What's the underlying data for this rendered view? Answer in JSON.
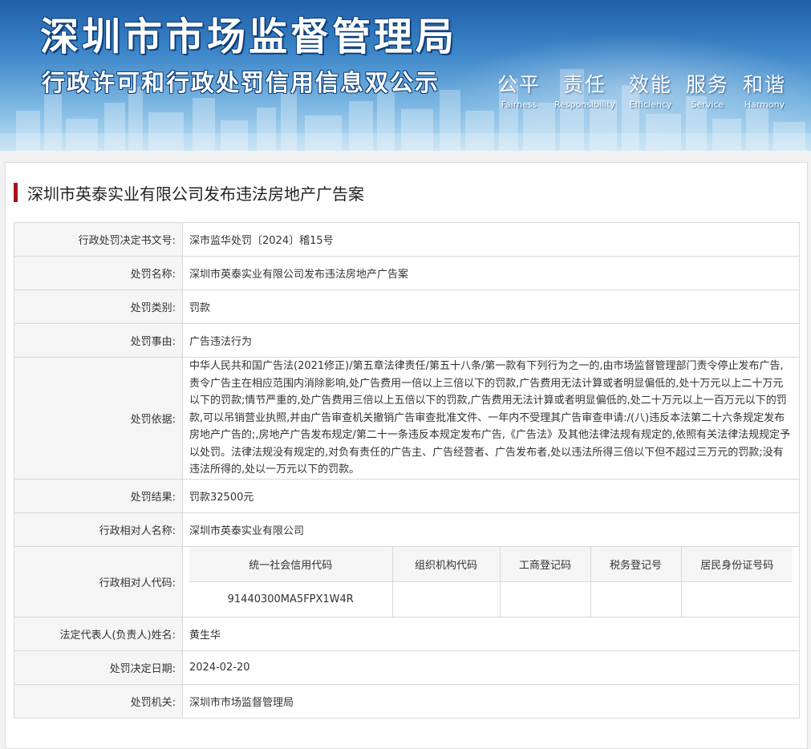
{
  "header": {
    "site_title": "深圳市市场监督管理局",
    "site_subtitle": "行政许可和行政处罚信用信息双公示",
    "values": [
      {
        "cn": "公平",
        "en": "Fairness"
      },
      {
        "cn": "责任",
        "en": "Responsibility"
      },
      {
        "cn": "效能",
        "en": "Efficiency"
      },
      {
        "cn": "服务",
        "en": "Service"
      },
      {
        "cn": "和谐",
        "en": "Harmony"
      }
    ]
  },
  "case": {
    "title": "深圳市英泰实业有限公司发布违法房地产广告案",
    "fields": {
      "doc_no_label": "行政处罚决定书文号:",
      "doc_no": "深市监华处罚〔2024〕稽15号",
      "name_label": "处罚名称:",
      "name": "深圳市英泰实业有限公司发布违法房地产广告案",
      "type_label": "处罚类别:",
      "type": "罚款",
      "reason_label": "处罚事由:",
      "reason": "广告违法行为",
      "basis_label": "处罚依据:",
      "basis": "中华人民共和国广告法(2021修正)/第五章法律责任/第五十八条/第一款有下列行为之一的,由市场监督管理部门责令停止发布广告,责令广告主在相应范围内消除影响,处广告费用一倍以上三倍以下的罚款,广告费用无法计算或者明显偏低的,处十万元以上二十万元以下的罚款;情节严重的,处广告费用三倍以上五倍以下的罚款,广告费用无法计算或者明显偏低的,处二十万元以上一百万元以下的罚款,可以吊销营业执照,并由广告审查机关撤销广告审查批准文件、一年内不受理其广告审查申请:/(八)违反本法第二十六条规定发布房地产广告的;,房地产广告发布规定/第二十一条违反本规定发布广告,《广告法》及其他法律法规有规定的,依照有关法律法规规定予以处罚。法律法规没有规定的,对负有责任的广告主、广告经营者、广告发布者,处以违法所得三倍以下但不超过三万元的罚款;没有违法所得的,处以一万元以下的罚款。",
      "result_label": "处罚结果:",
      "result": "罚款32500元",
      "party_name_label": "行政相对人名称:",
      "party_name": "深圳市英泰实业有限公司",
      "party_code_label": "行政相对人代码:",
      "legal_rep_label": "法定代表人(负责人)姓名:",
      "legal_rep": "黄生华",
      "date_label": "处罚决定日期:",
      "date": "2024-02-20",
      "authority_label": "处罚机关:",
      "authority": "深圳市市场监督管理局"
    },
    "codes": {
      "headers": [
        "统一社会信用代码",
        "组织机构代码",
        "工商登记码",
        "税务登记号",
        "居民身份证号码"
      ],
      "values": [
        "91440300MA5FPX1W4R",
        "",
        "",
        "",
        ""
      ]
    }
  }
}
